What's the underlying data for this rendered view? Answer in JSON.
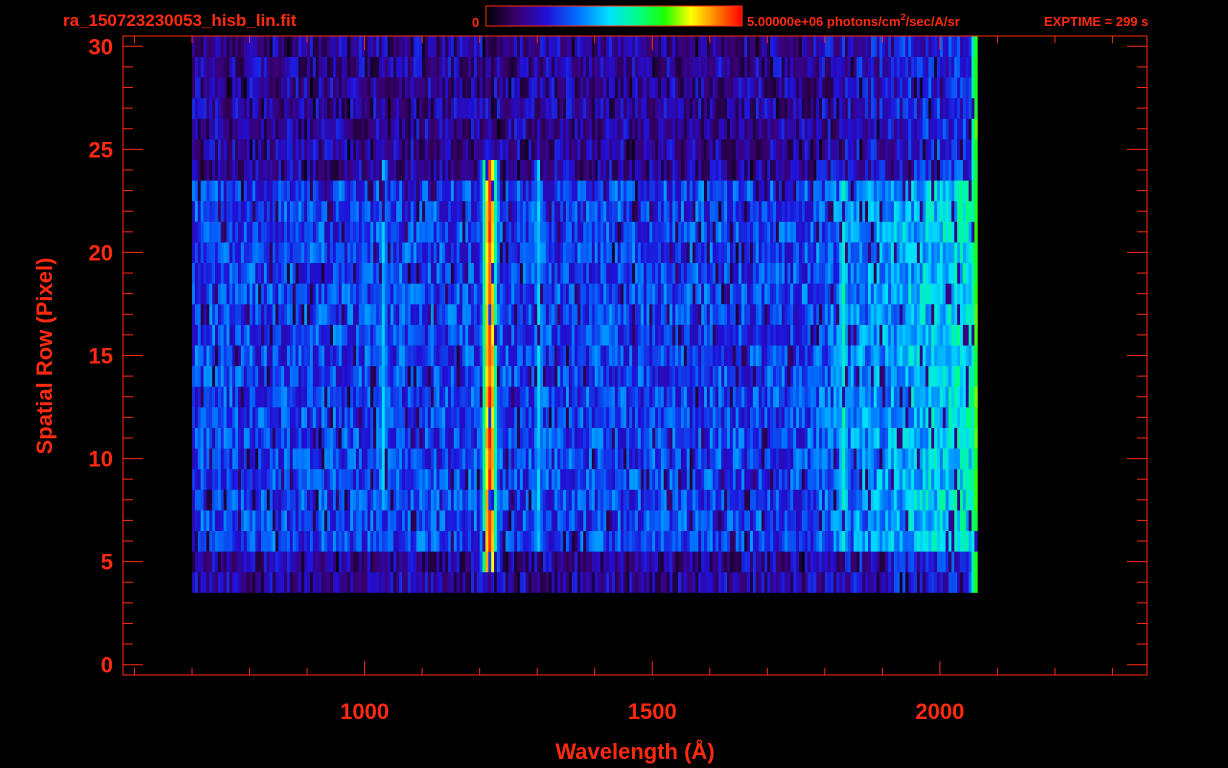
{
  "colors": {
    "background": "#000000",
    "frame": "#ff2a10",
    "text": "#ff2a10"
  },
  "chart_data": {
    "type": "heatmap",
    "title": "ra_150723230053_hisb_lin.fit",
    "colorbar": {
      "min_label": "0",
      "max_label": "5.00000e+06 photons/cm",
      "max_label_sup": "2",
      "max_label_tail": "/sec/A/sr",
      "min_value": 0,
      "max_value": 5000000,
      "colormap": "rainbow (black-purple-blue-cyan-green-yellow-red)"
    },
    "exptime_label": "EXPTIME = 299 s",
    "xlabel": "Wavelength (Å)",
    "ylabel": "Spatial Row (Pixel)",
    "xlim": [
      580,
      2360
    ],
    "ylim": [
      -0.5,
      30.5
    ],
    "xticks": [
      1000,
      1500,
      2000
    ],
    "xtick_labels": [
      "1000",
      "1500",
      "2000"
    ],
    "yticks": [
      0,
      5,
      10,
      15,
      20,
      25,
      30
    ],
    "ytick_labels": [
      "0",
      "5",
      "10",
      "15",
      "20",
      "25",
      "30"
    ],
    "x_minor_step": 100,
    "y_minor_step": 1,
    "grid": false,
    "data_extent": {
      "wavelength_range": [
        700,
        2065
      ],
      "row_range": [
        4,
        30
      ],
      "bright_band_rows": [
        6,
        23
      ]
    },
    "emission_features": [
      {
        "wavelength": 1215,
        "rows": [
          5,
          24
        ],
        "peak_fraction": 0.95,
        "label": ""
      },
      {
        "wavelength": 1030,
        "rows": [
          8,
          24
        ],
        "peak_fraction": 0.45
      },
      {
        "wavelength": 1300,
        "rows": [
          6,
          24
        ],
        "peak_fraction": 0.45
      },
      {
        "wavelength": 1830,
        "rows": [
          6,
          23
        ],
        "peak_fraction": 0.55
      },
      {
        "wavelength": 2060,
        "rows": [
          2,
          30
        ],
        "peak_fraction": 0.7
      }
    ]
  }
}
